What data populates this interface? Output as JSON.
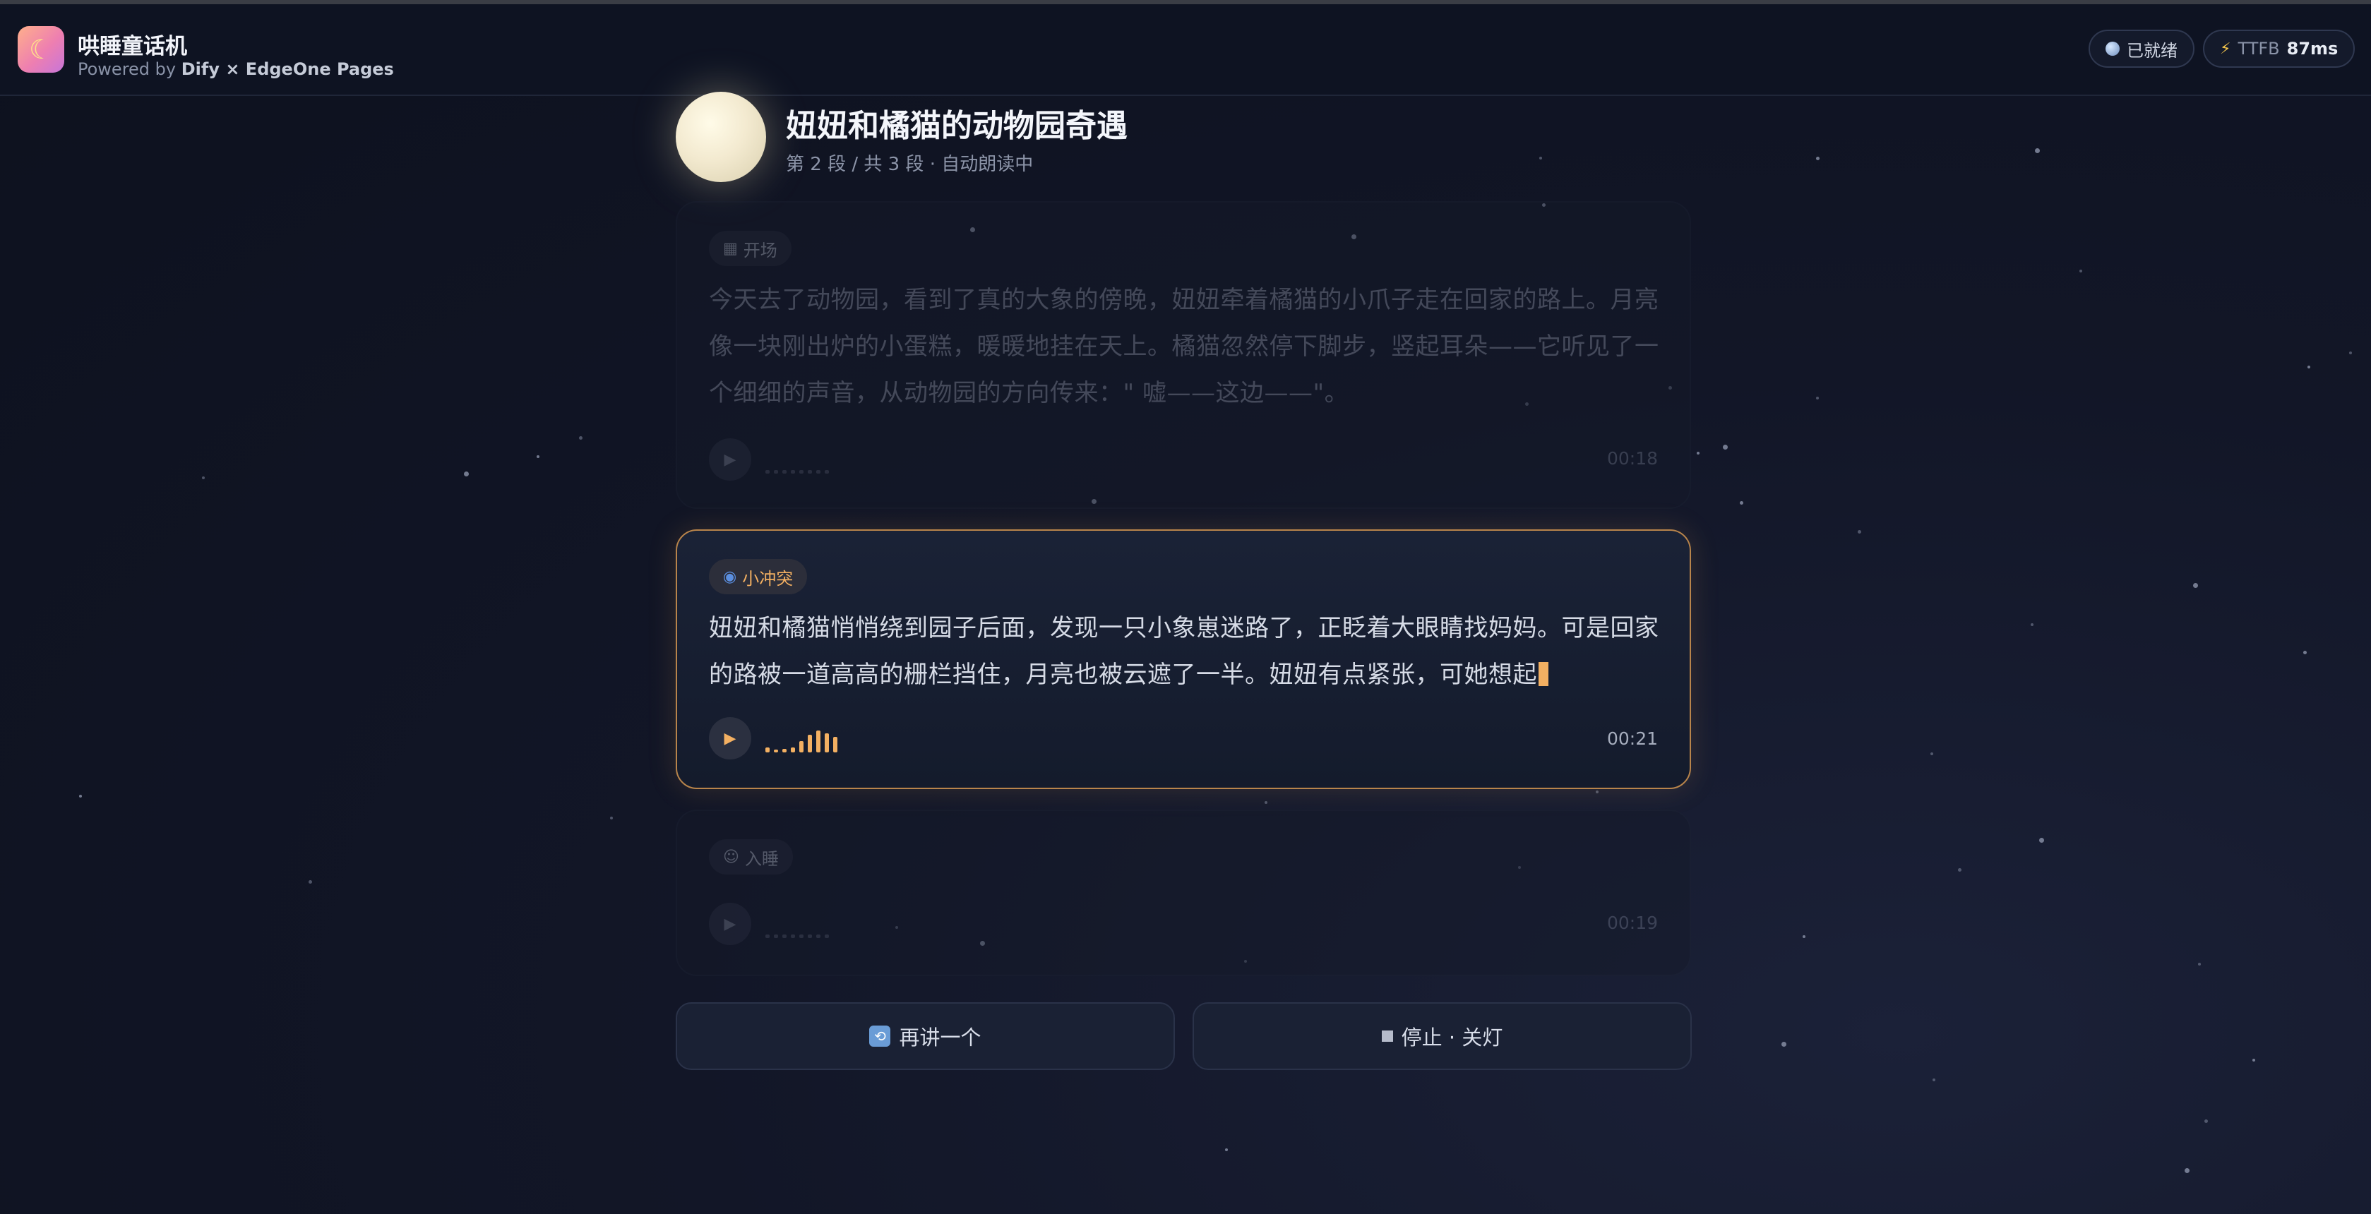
{
  "header": {
    "app_icon": "crescent-moon-icon",
    "title": "哄睡童话机",
    "powered_prefix": "Powered by",
    "powered_brand": "Dify × EdgeOne Pages",
    "status_label": "已就绪",
    "ttfb_label": "TTFB",
    "ttfb_value": "87ms"
  },
  "story": {
    "title": "妞妞和橘猫的动物园奇遇",
    "subtitle": "第 2 段 / 共 3 段 · 自动朗读中"
  },
  "segments": [
    {
      "tag": "开场",
      "tag_icon": "film-icon",
      "text": "今天去了动物园，看到了真的大象的傍晚，妞妞牵着橘猫的小爪子走在回家的路上。月亮像一块刚出炉的小蛋糕，暖暖地挂在天上。橘猫忽然停下脚步，竖起耳朵——它听见了一个细细的声音，从动物园的方向传来：\" 嘘——这边——\"。",
      "duration": "00:18",
      "state": "done"
    },
    {
      "tag": "小冲突",
      "tag_icon": "swirl-icon",
      "text": "妞妞和橘猫悄悄绕到园子后面，发现一只小象崽迷路了，正眨着大眼睛找妈妈。可是回家的路被一道高高的栅栏挡住，月亮也被云遮了一半。妞妞有点紧张，可她想起",
      "duration": "00:21",
      "state": "playing",
      "wave_levels": [
        0.2,
        0.1,
        0.15,
        0.2,
        0.45,
        0.7,
        0.85,
        0.75,
        0.6
      ]
    },
    {
      "tag": "入睡",
      "tag_icon": "sleeping-face-icon",
      "text": "",
      "duration": "00:19",
      "state": "pending"
    }
  ],
  "actions": {
    "again_label": "再讲一个",
    "stop_label": "停止 · 关灯"
  },
  "colors": {
    "accent": "#f3b062",
    "background": "#121627",
    "card": "#151a29",
    "active_border": "#b8844b"
  }
}
